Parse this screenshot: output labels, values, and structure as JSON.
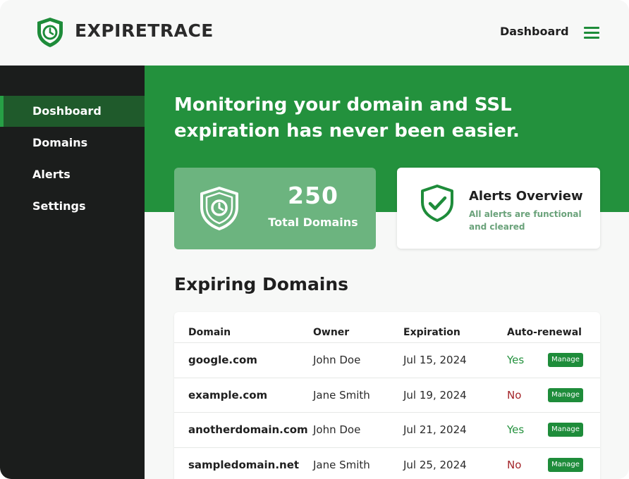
{
  "header": {
    "brand": "EXPIRETRACE",
    "nav_label": "Dashboard",
    "logo_icon": "clock-shield-icon",
    "menu_icon": "hamburger-menu-icon"
  },
  "sidebar": {
    "items": [
      {
        "label": "Doshboard",
        "active": true
      },
      {
        "label": "Domains",
        "active": false
      },
      {
        "label": "Alerts",
        "active": false
      },
      {
        "label": "Settings",
        "active": false
      }
    ]
  },
  "hero": {
    "title": "Monitoring your domain and SSL expiration has never been easier."
  },
  "cards": {
    "total": {
      "value": "250",
      "label": "Total Domains",
      "icon": "shield-clock-icon"
    },
    "alerts": {
      "title": "Alerts Overview",
      "subtitle": "All alerts are functional and cleared",
      "icon": "shield-check-icon"
    }
  },
  "table": {
    "title": "Expiring Domains",
    "headers": [
      "Domain",
      "Owner",
      "Expiration",
      "Auto-renewal"
    ],
    "manage_label": "Manage",
    "rows": [
      {
        "domain": "google.com",
        "owner": "John Doe",
        "expiration": "Jul 15, 2024",
        "auto_renewal": "Yes"
      },
      {
        "domain": "example.com",
        "owner": "Jane Smith",
        "expiration": "Jul 19, 2024",
        "auto_renewal": "No"
      },
      {
        "domain": "anotherdomain.com",
        "owner": "John Doe",
        "expiration": "Jul 21, 2024",
        "auto_renewal": "Yes"
      },
      {
        "domain": "sampledomain.net",
        "owner": "Jane Smith",
        "expiration": "Jul 25, 2024",
        "auto_renewal": "No"
      }
    ]
  },
  "colors": {
    "accent": "#23913d",
    "sidebar": "#1b1d1c",
    "yes": "#23913d",
    "no": "#a4252a"
  }
}
